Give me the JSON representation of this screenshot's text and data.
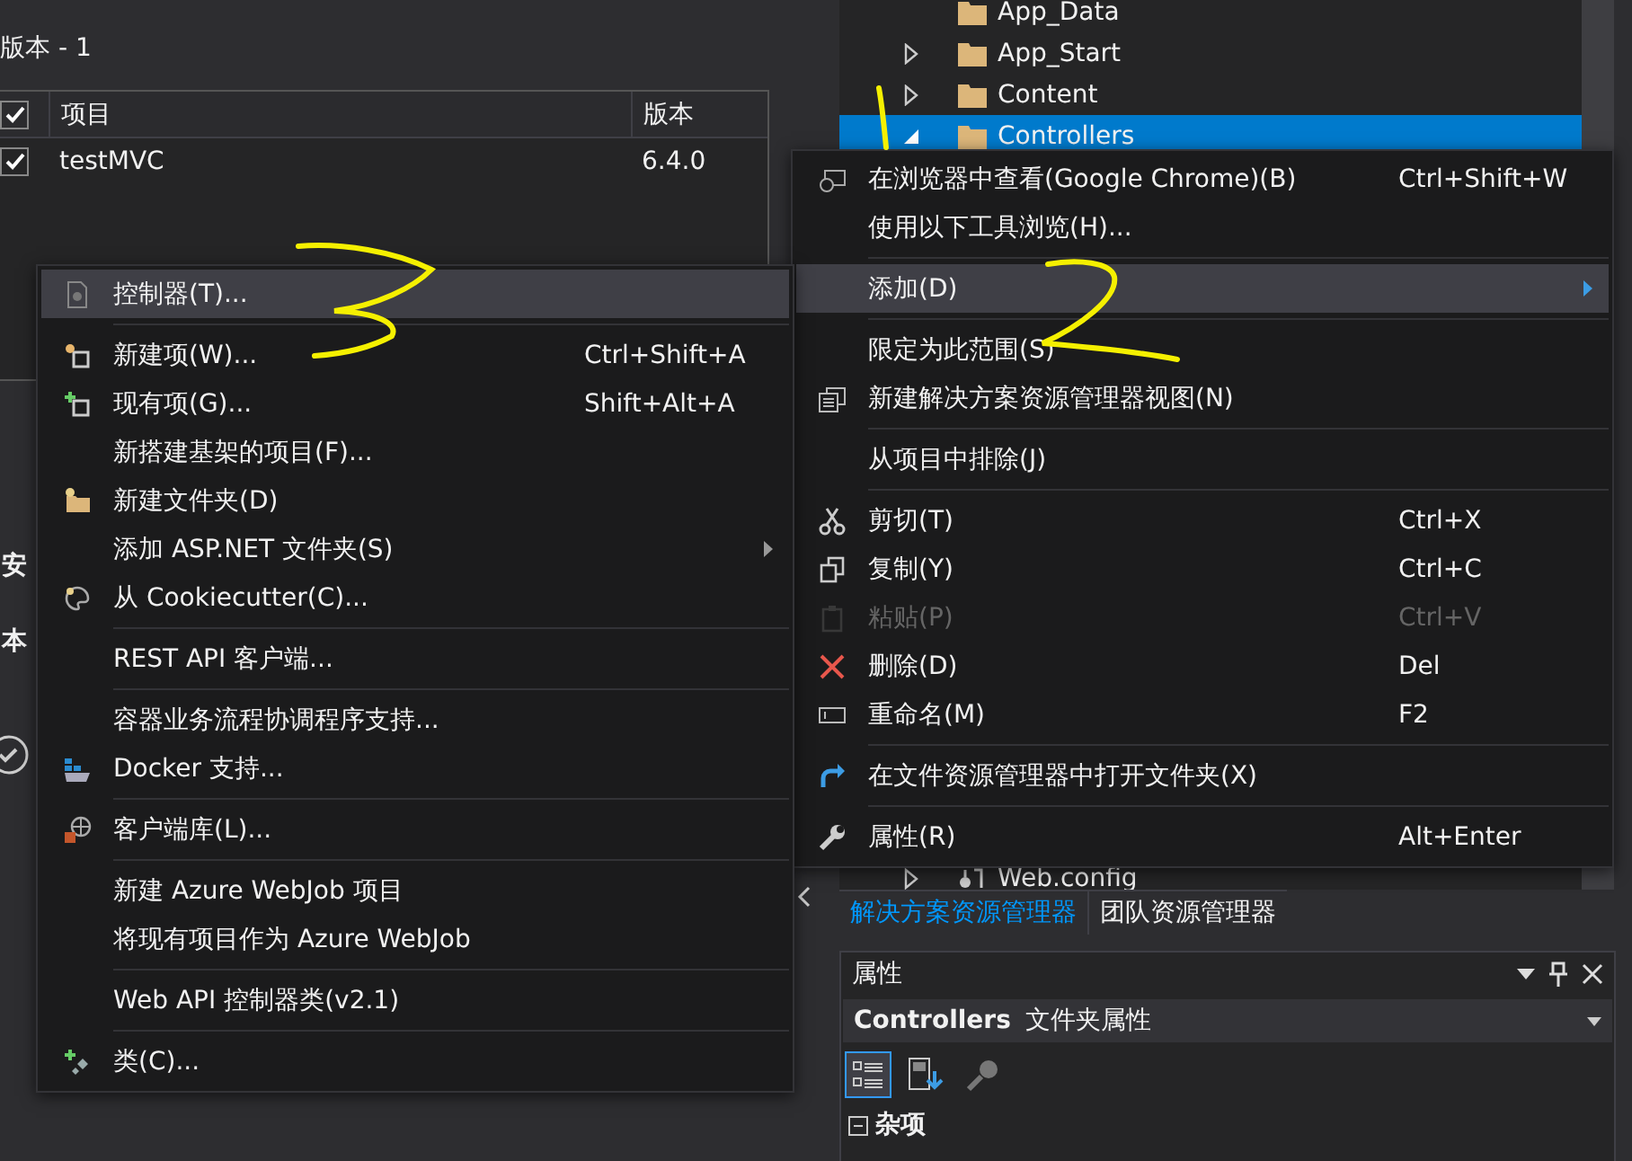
{
  "left_panel": {
    "heading": "版本 - 1",
    "table": {
      "header_checked": true,
      "columns": [
        {
          "label": "项目"
        },
        {
          "label": "版本"
        }
      ],
      "rows": [
        {
          "checked": true,
          "name": "testMVC",
          "version": "6.4.0"
        }
      ]
    },
    "side_labels": [
      "安",
      "本"
    ]
  },
  "solution_explorer": {
    "items": [
      {
        "kind": "folder",
        "label": "App_Data",
        "expandable": false,
        "selected": false
      },
      {
        "kind": "folder",
        "label": "App_Start",
        "expandable": true,
        "expanded": false,
        "selected": false
      },
      {
        "kind": "folder",
        "label": "Content",
        "expandable": true,
        "expanded": false,
        "selected": false
      },
      {
        "kind": "folder",
        "label": "Controllers",
        "expandable": true,
        "expanded": true,
        "selected": true
      },
      {
        "kind": "file",
        "label": "Web.config",
        "expandable": true,
        "expanded": false,
        "selected": false
      }
    ]
  },
  "tabs": [
    {
      "label": "解决方案资源管理器",
      "selected": true
    },
    {
      "label": "团队资源管理器",
      "selected": false
    }
  ],
  "properties": {
    "title": "属性",
    "object_name": "Controllers",
    "object_type": "文件夹属性",
    "category": "杂项",
    "category_expanded": true
  },
  "context_menu": {
    "groups": [
      [
        {
          "label": "在浏览器中查看(Google Chrome)(B)",
          "shortcut": "Ctrl+Shift+W",
          "selected": false,
          "disabled": false,
          "submenu": false
        },
        {
          "label": "使用以下工具浏览(H)...",
          "selected": false,
          "disabled": false,
          "submenu": false
        }
      ],
      [
        {
          "label": "添加(D)",
          "selected": true,
          "disabled": false,
          "submenu": true
        }
      ],
      [
        {
          "label": "限定为此范围(S)",
          "selected": false,
          "disabled": false,
          "submenu": false
        },
        {
          "label": "新建解决方案资源管理器视图(N)",
          "selected": false,
          "disabled": false,
          "submenu": false
        }
      ],
      [
        {
          "label": "从项目中排除(J)",
          "selected": false,
          "disabled": false,
          "submenu": false
        }
      ],
      [
        {
          "label": "剪切(T)",
          "shortcut": "Ctrl+X",
          "selected": false,
          "disabled": false,
          "submenu": false
        },
        {
          "label": "复制(Y)",
          "shortcut": "Ctrl+C",
          "selected": false,
          "disabled": false,
          "submenu": false
        },
        {
          "label": "粘贴(P)",
          "shortcut": "Ctrl+V",
          "selected": false,
          "disabled": true,
          "submenu": false
        },
        {
          "label": "删除(D)",
          "shortcut": "Del",
          "selected": false,
          "disabled": false,
          "submenu": false
        },
        {
          "label": "重命名(M)",
          "shortcut": "F2",
          "selected": false,
          "disabled": false,
          "submenu": false
        }
      ],
      [
        {
          "label": "在文件资源管理器中打开文件夹(X)",
          "selected": false,
          "disabled": false,
          "submenu": false
        }
      ],
      [
        {
          "label": "属性(R)",
          "shortcut": "Alt+Enter",
          "selected": false,
          "disabled": false,
          "submenu": false
        }
      ]
    ]
  },
  "submenu": {
    "groups": [
      [
        {
          "label": "控制器(T)...",
          "selected": true,
          "disabled": false,
          "submenu": false
        }
      ],
      [
        {
          "label": "新建项(W)...",
          "shortcut": "Ctrl+Shift+A",
          "selected": false,
          "disabled": false,
          "submenu": false
        },
        {
          "label": "现有项(G)...",
          "shortcut": "Shift+Alt+A",
          "selected": false,
          "disabled": false,
          "submenu": false
        },
        {
          "label": "新搭建基架的项目(F)...",
          "selected": false,
          "disabled": false,
          "submenu": false
        },
        {
          "label": "新建文件夹(D)",
          "selected": false,
          "disabled": false,
          "submenu": false
        },
        {
          "label": "添加 ASP.NET 文件夹(S)",
          "selected": false,
          "disabled": false,
          "submenu": true
        },
        {
          "label": "从 Cookiecutter(C)...",
          "selected": false,
          "disabled": false,
          "submenu": false
        }
      ],
      [
        {
          "label": "REST API 客户端...",
          "selected": false,
          "disabled": false,
          "submenu": false
        }
      ],
      [
        {
          "label": "容器业务流程协调程序支持...",
          "selected": false,
          "disabled": false,
          "submenu": false
        },
        {
          "label": "Docker 支持...",
          "selected": false,
          "disabled": false,
          "submenu": false
        }
      ],
      [
        {
          "label": "客户端库(L)...",
          "selected": false,
          "disabled": false,
          "submenu": false
        }
      ],
      [
        {
          "label": "新建 Azure WebJob 项目",
          "selected": false,
          "disabled": false,
          "submenu": false
        },
        {
          "label": "将现有项目作为 Azure WebJob",
          "selected": false,
          "disabled": false,
          "submenu": false
        }
      ],
      [
        {
          "label": "Web API 控制器类(v2.1)",
          "selected": false,
          "disabled": false,
          "submenu": false
        }
      ],
      [
        {
          "label": "类(C)...",
          "selected": false,
          "disabled": false,
          "submenu": false
        }
      ]
    ]
  }
}
